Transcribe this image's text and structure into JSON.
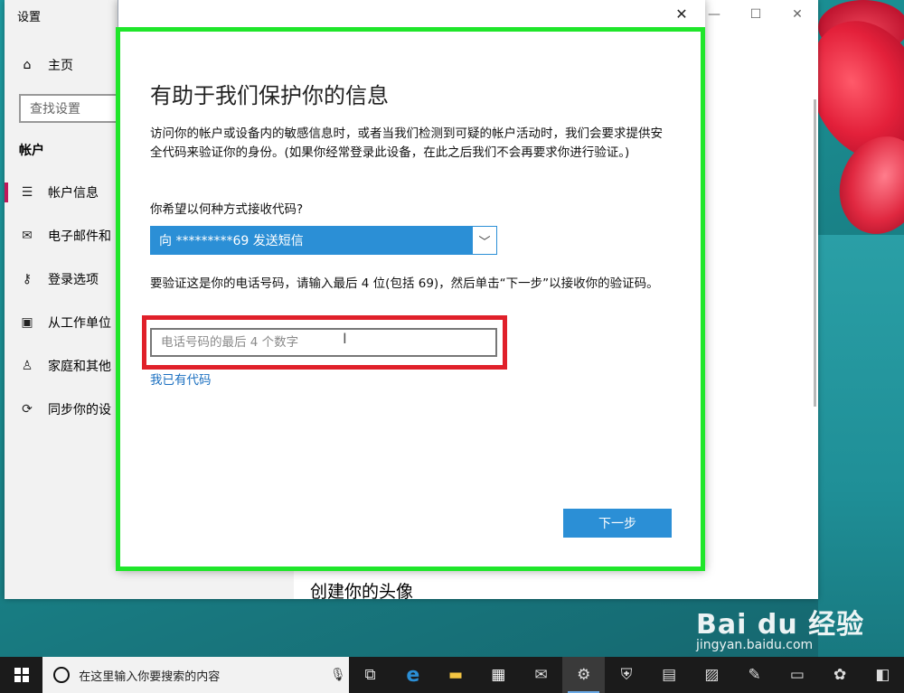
{
  "settings": {
    "title": "设置",
    "home": "主页",
    "search_placeholder": "查找设置",
    "section": "帐户",
    "nav": [
      {
        "label": "帐户信息",
        "icon": "person-card-icon"
      },
      {
        "label": "电子邮件和",
        "icon": "mail-icon"
      },
      {
        "label": "登录选项",
        "icon": "key-icon"
      },
      {
        "label": "从工作单位",
        "icon": "briefcase-icon"
      },
      {
        "label": "家庭和其他",
        "icon": "person-add-icon"
      },
      {
        "label": "同步你的设",
        "icon": "sync-icon"
      }
    ],
    "main_heading": "创建你的头像"
  },
  "dialog": {
    "heading": "有助于我们保护你的信息",
    "description": "访问你的帐户或设备内的敏感信息时，或者当我们检测到可疑的帐户活动时，我们会要求提供安全代码来验证你的身份。(如果你经常登录此设备，在此之后我们不会再要求你进行验证。)",
    "question": "你希望以何种方式接收代码?",
    "method_selected": "向 *********69 发送短信",
    "verify_text": "要验证这是你的电话号码，请输入最后 4 位(包括 69)，然后单击“下一步”以接收你的验证码。",
    "input_placeholder": "电话号码的最后 4 个数字",
    "have_code_link": "我已有代码",
    "next_button": "下一步"
  },
  "taskbar": {
    "search_text": "在这里输入你要搜索的内容"
  },
  "watermark": {
    "brand": "Bai du 经验",
    "url": "jingyan.baidu.com"
  },
  "colors": {
    "accent": "#2b8fd6",
    "highlight_green": "#1fe62a",
    "highlight_red": "#e0202a",
    "nav_active": "#c0185a"
  }
}
